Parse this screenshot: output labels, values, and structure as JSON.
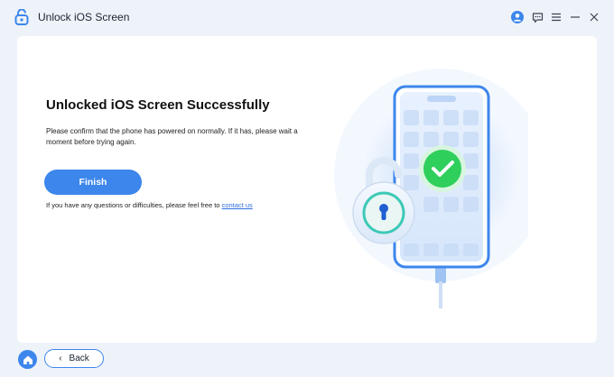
{
  "app": {
    "title": "Unlock iOS Screen"
  },
  "titlebar": {
    "icons": [
      "user-icon",
      "feedback-icon",
      "menu-icon",
      "minimize-icon",
      "close-icon"
    ]
  },
  "main": {
    "headline": "Unlocked iOS Screen Successfully",
    "description": "Please confirm that the phone has powered on normally. If it has, please wait a moment before trying again.",
    "finish_label": "Finish",
    "help_text": "If you have any questions or difficulties, please feel free to ",
    "help_link": "contact us"
  },
  "footer": {
    "back_label": "Back"
  },
  "colors": {
    "accent": "#3c86ec",
    "success": "#2fcf5b",
    "background": "#eef3fa"
  }
}
